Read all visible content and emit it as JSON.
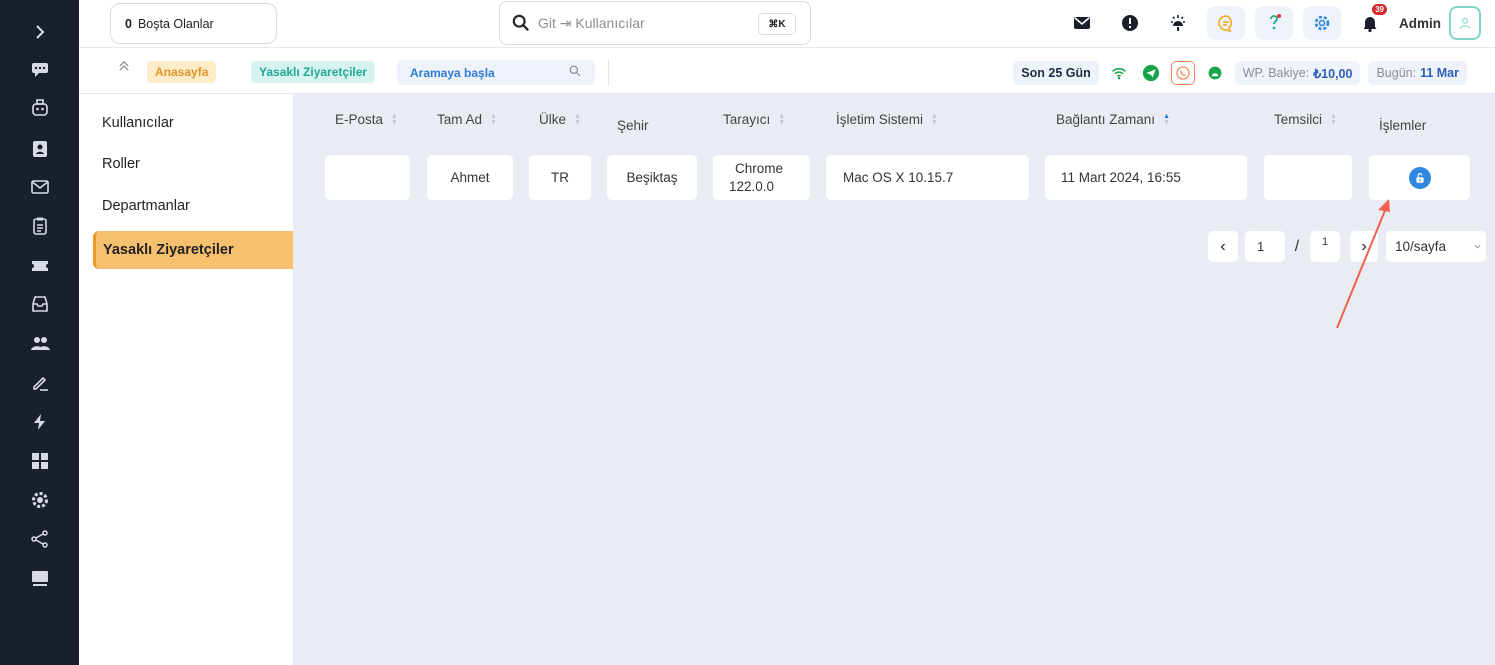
{
  "topbar": {
    "idle_count": "0",
    "idle_label": "Boşta Olanlar",
    "search_placeholder": "Git ⇥ Kullanıcılar",
    "search_shortcut": "⌘K",
    "notification_count": "39",
    "user_name": "Admin"
  },
  "breadcrumb": {
    "home": "Anasayfa",
    "current": "Yasaklı Ziyaretçiler",
    "search_start": "Aramaya başla",
    "period": "Son 25 Gün",
    "balance_label": "WP. Bakiye:",
    "balance_value": "₺10,00",
    "today_label": "Bugün:",
    "today_value": "11 Mar"
  },
  "subnav": {
    "items": [
      {
        "label": "Kullanıcılar"
      },
      {
        "label": "Roller"
      },
      {
        "label": "Departmanlar"
      },
      {
        "label": "Yasaklı Ziyaretçiler"
      }
    ]
  },
  "table": {
    "columns": [
      "E-Posta",
      "Tam Ad",
      "Ülke",
      "Şehir",
      "Tarayıcı",
      "İşletim Sistemi",
      "Bağlantı Zamanı",
      "Temsilci",
      "İşlemler"
    ],
    "rows": [
      {
        "email": "",
        "full_name": "Ahmet",
        "country": "TR",
        "city": "Beşiktaş",
        "browser_name": "Chrome",
        "browser_version": "122.0.0",
        "os": "Mac OS X 10.15.7",
        "connected_at": "11 Mart 2024, 16:55",
        "agent": ""
      }
    ]
  },
  "pagination": {
    "current_page": "1",
    "separator": "/",
    "total_pages": "1",
    "page_size": "10/sayfa"
  },
  "colors": {
    "sidebar": "#1a1f2c",
    "accent_orange": "#f7c06e",
    "accent_teal": "#1fa892",
    "accent_blue": "#2e86de",
    "annotation_arrow": "#f0604d"
  }
}
